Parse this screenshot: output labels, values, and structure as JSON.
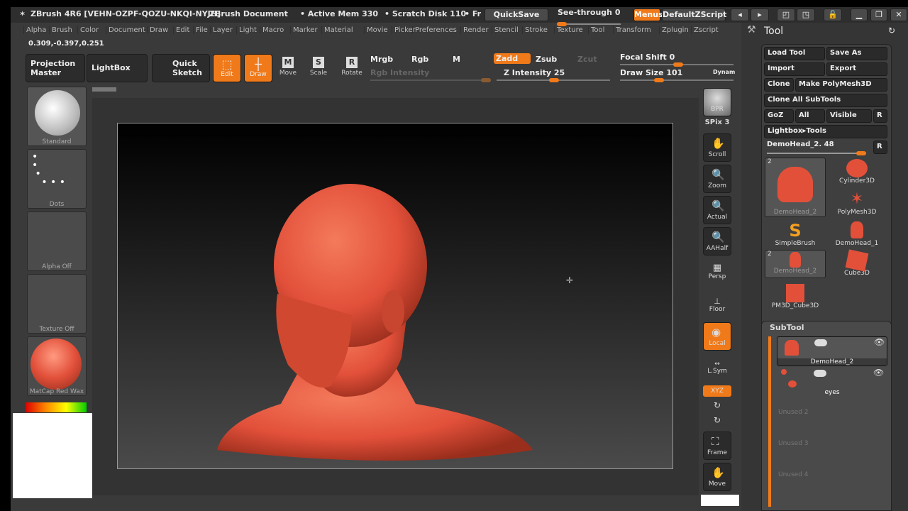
{
  "title_bar": {
    "app": "ZBrush 4R6 [VEHN-OZPF-QOZU-NKQI-NYJH]",
    "document": "ZBrush Document",
    "active_mem": "• Active Mem 330",
    "scratch_disk": "• Scratch Disk 110",
    "fr": "• Fr",
    "quicksave": "QuickSave",
    "see_through": "See-through  0",
    "menus": "Menus",
    "default_zscript": "DefaultZScript"
  },
  "menus": [
    "Alpha",
    "Brush",
    "Color",
    "Document",
    "Draw",
    "Edit",
    "File",
    "Layer",
    "Light",
    "Macro",
    "Marker",
    "Material",
    "Movie",
    "Picker",
    "Preferences",
    "Render",
    "Stencil",
    "Stroke",
    "Texture",
    "Tool",
    "Transform",
    "Zplugin",
    "Zscript"
  ],
  "coords": "0.309,-0.397,0.251",
  "toolbar": {
    "projection_master": "Projection Master",
    "lightbox": "LightBox",
    "quick_sketch": "Quick Sketch",
    "edit": "Edit",
    "draw": "Draw",
    "move": "Move",
    "scale": "Scale",
    "rotate": "Rotate",
    "mrgb": "Mrgb",
    "rgb": "Rgb",
    "m": "M",
    "rgb_intensity": "Rgb  Intensity",
    "zadd": "Zadd",
    "zsub": "Zsub",
    "zcut": "Zcut",
    "z_intensity": "Z Intensity 25",
    "focal_shift": "Focal Shift 0",
    "draw_size": "Draw Size 101",
    "dynamic": "Dynam"
  },
  "sliders": {
    "z_intensity": 25,
    "draw_size": 101,
    "focal_shift": 0,
    "see_through": 0
  },
  "left_shelf": {
    "brush": "Standard",
    "stroke": "Dots",
    "alpha": "Alpha  Off",
    "texture": "Texture  Off",
    "material": "MatCap  Red  Wax"
  },
  "right_shelf": {
    "bpr": "BPR",
    "spix": "SPix 3",
    "scroll": "Scroll",
    "zoom": "Zoom",
    "actual": "Actual",
    "aahalf": "AAHalf",
    "persp": "Persp",
    "floor": "Floor",
    "local": "Local",
    "lsym": "L.Sym",
    "xyz": "XYZ",
    "frame": "Frame",
    "move": "Move"
  },
  "tool_panel": {
    "title": "Tool",
    "load_tool": "Load Tool",
    "save_as": "Save As",
    "import": "Import",
    "export": "Export",
    "clone": "Clone",
    "make_polymesh": "Make PolyMesh3D",
    "clone_all": "Clone All SubTools",
    "goz": "GoZ",
    "all": "All",
    "visible": "Visible",
    "r": "R",
    "lightbox_tools": "Lightbox▸Tools",
    "current_tool": "DemoHead_2. 48",
    "tools": [
      {
        "name": "DemoHead_2",
        "count": "2"
      },
      {
        "name": "Cylinder3D"
      },
      {
        "name": "PolyMesh3D"
      },
      {
        "name": "SimpleBrush"
      },
      {
        "name": "DemoHead_1"
      },
      {
        "name": "DemoHead_2",
        "count": "2"
      },
      {
        "name": "Cube3D"
      },
      {
        "name": "PM3D_Cube3D"
      }
    ]
  },
  "subtool": {
    "title": "SubTool",
    "items": [
      "DemoHead_2",
      "eyes"
    ],
    "unused": [
      "Unused  2",
      "Unused  3",
      "Unused  4"
    ]
  },
  "colors": {
    "accent": "#f07a1a",
    "model": "#e2503a"
  }
}
